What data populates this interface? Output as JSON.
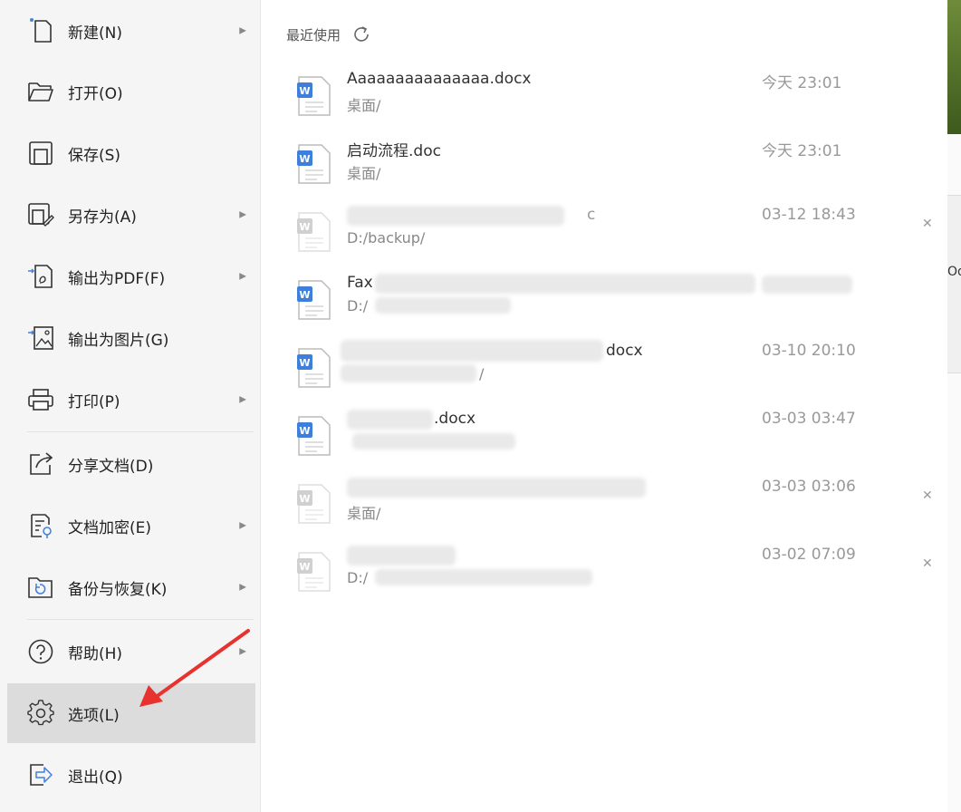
{
  "menu": {
    "items": [
      {
        "label": "新建(N)",
        "icon": "new-file-icon",
        "arrow": true
      },
      {
        "label": "打开(O)",
        "icon": "folder-open-icon",
        "arrow": false
      },
      {
        "label": "保存(S)",
        "icon": "save-icon",
        "arrow": false
      },
      {
        "label": "另存为(A)",
        "icon": "save-as-icon",
        "arrow": true
      },
      {
        "label": "输出为PDF(F)",
        "icon": "export-pdf-icon",
        "arrow": true
      },
      {
        "label": "输出为图片(G)",
        "icon": "export-image-icon",
        "arrow": false
      },
      {
        "label": "打印(P)",
        "icon": "printer-icon",
        "arrow": true
      },
      {
        "label": "分享文档(D)",
        "icon": "share-icon",
        "arrow": false
      },
      {
        "label": "文档加密(E)",
        "icon": "encrypt-icon",
        "arrow": true
      },
      {
        "label": "备份与恢复(K)",
        "icon": "backup-restore-icon",
        "arrow": true
      },
      {
        "label": "帮助(H)",
        "icon": "help-icon",
        "arrow": true
      },
      {
        "label": "选项(L)",
        "icon": "gear-icon",
        "arrow": false,
        "selected": true
      },
      {
        "label": "退出(Q)",
        "icon": "exit-icon",
        "arrow": false
      }
    ]
  },
  "recent": {
    "title": "最近使用",
    "files": [
      {
        "name": "Aaaaaaaaaaaaaaa.docx",
        "path": "桌面/",
        "time": "今天 23:01",
        "active": true,
        "removable": false
      },
      {
        "name": "启动流程.doc",
        "path": "桌面/",
        "time": "今天 23:01",
        "active": true,
        "removable": false
      },
      {
        "name": "c",
        "path": "D:/backup/",
        "time": "03-12 18:43",
        "active": false,
        "removable": true
      },
      {
        "name": "Fax",
        "path": "D:/",
        "time": "",
        "active": true,
        "removable": false
      },
      {
        "name": "docx",
        "path": "/",
        "time": "03-10 20:10",
        "active": true,
        "removable": false
      },
      {
        "name": ".docx",
        "path": "",
        "time": "03-03 03:47",
        "active": true,
        "removable": false
      },
      {
        "name": "",
        "path": "桌面/",
        "time": "03-03 03:06",
        "active": false,
        "removable": true
      },
      {
        "name": "",
        "path": "D:/",
        "time": "03-02 07:09",
        "active": false,
        "removable": true
      }
    ]
  },
  "background": {
    "edge_text": "Od"
  },
  "colors": {
    "word_blue": "#3f7fdc",
    "selected_bg": "#dcdcdc",
    "annotation_red": "#e8322e"
  }
}
